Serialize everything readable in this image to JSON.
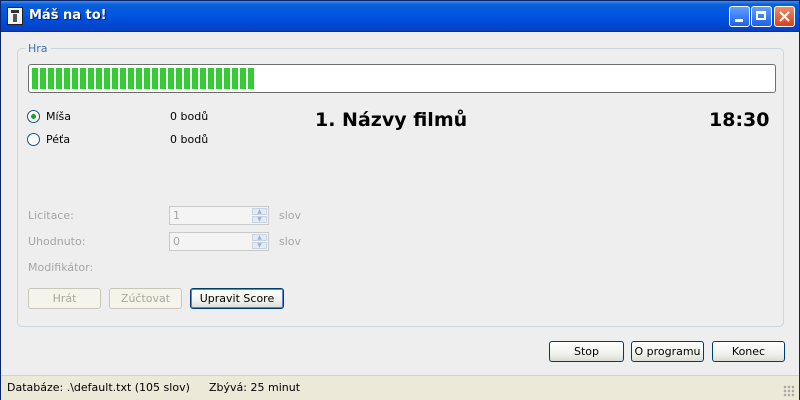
{
  "window": {
    "title": "Máš na to!",
    "controls": [
      "minimize",
      "maximize",
      "close"
    ]
  },
  "game": {
    "group_label": "Hra",
    "progress_fraction": 0.3,
    "players": [
      {
        "name": "Míša",
        "score": "0 bodů",
        "selected": true
      },
      {
        "name": "Péťa",
        "score": "0 bodů",
        "selected": false
      }
    ],
    "category": "1. Názvy filmů",
    "timer": "18:30",
    "fields": {
      "licitace_label": "Licitace:",
      "licitace_value": "1",
      "licitace_unit": "slov",
      "uhodnuto_label": "Uhodnuto:",
      "uhodnuto_value": "0",
      "uhodnuto_unit": "slov",
      "modifikator_label": "Modifikátor:"
    },
    "buttons": {
      "hrat": "Hrát",
      "zuctovat": "Zúčtovat",
      "upravit_score": "Upravit Score"
    }
  },
  "footer_buttons": {
    "stop": "Stop",
    "o_programu": "O programu",
    "konec": "Konec"
  },
  "status": {
    "database": "Databáze: .\\default.txt (105 slov)",
    "remaining": "Zbývá: 25 minut"
  },
  "colors": {
    "progress": "#33cc33",
    "titlebar": "#0055e5",
    "legend": "#3e6fb8",
    "disabled_text": "#a6a6a6"
  }
}
